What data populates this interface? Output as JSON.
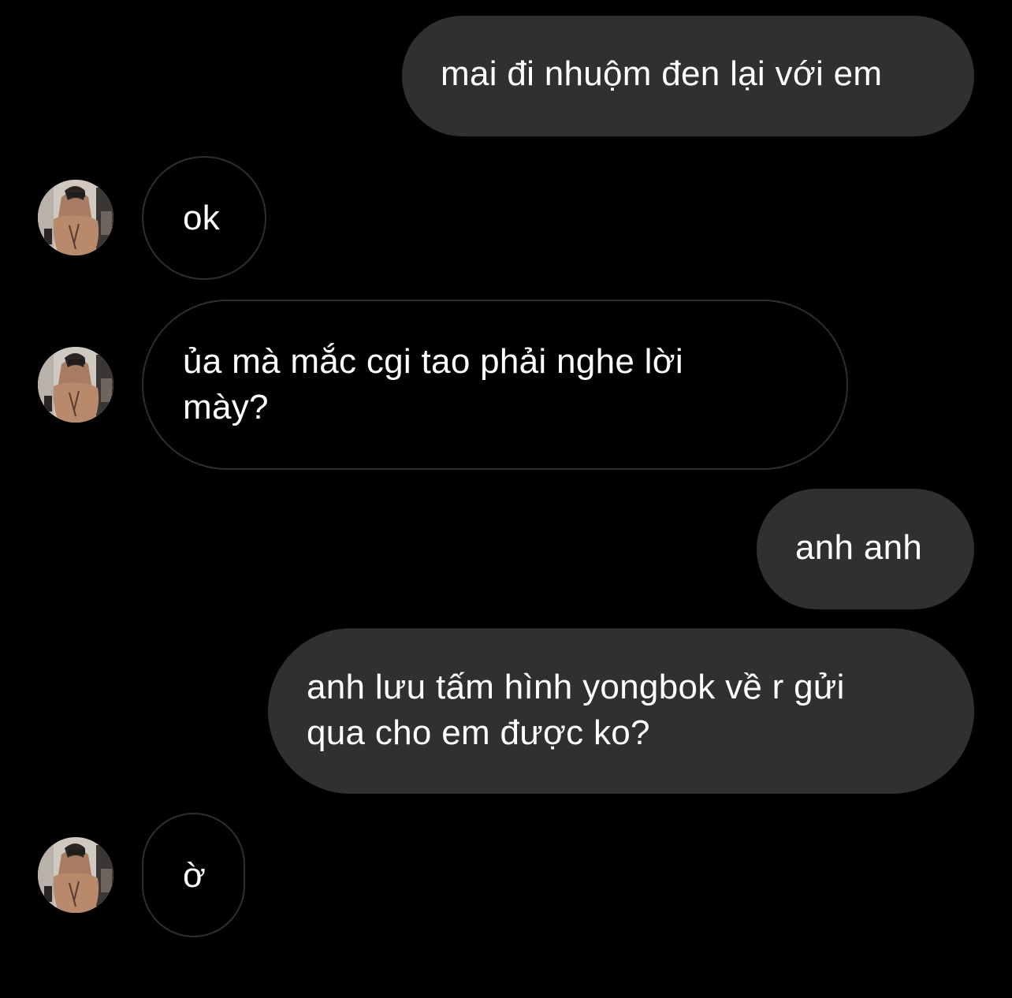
{
  "colors": {
    "background": "#000000",
    "sent_bubble": "#303030",
    "received_border": "#2f2f2f",
    "text": "#ffffff"
  },
  "messages": [
    {
      "direction": "sent",
      "text": "mai đi nhuộm đen lại với em"
    },
    {
      "direction": "received",
      "text": "ok",
      "avatar": "profile-photo"
    },
    {
      "direction": "received",
      "lines": [
        "ủa mà mắc cgi tao phải nghe lời",
        "mày?"
      ],
      "avatar": "profile-photo"
    },
    {
      "direction": "sent",
      "text": "anh anh"
    },
    {
      "direction": "sent",
      "lines": [
        "anh lưu tấm hình yongbok về r gửi",
        "qua cho em được ko?"
      ]
    },
    {
      "direction": "received",
      "text": "ờ",
      "avatar": "profile-photo"
    }
  ]
}
